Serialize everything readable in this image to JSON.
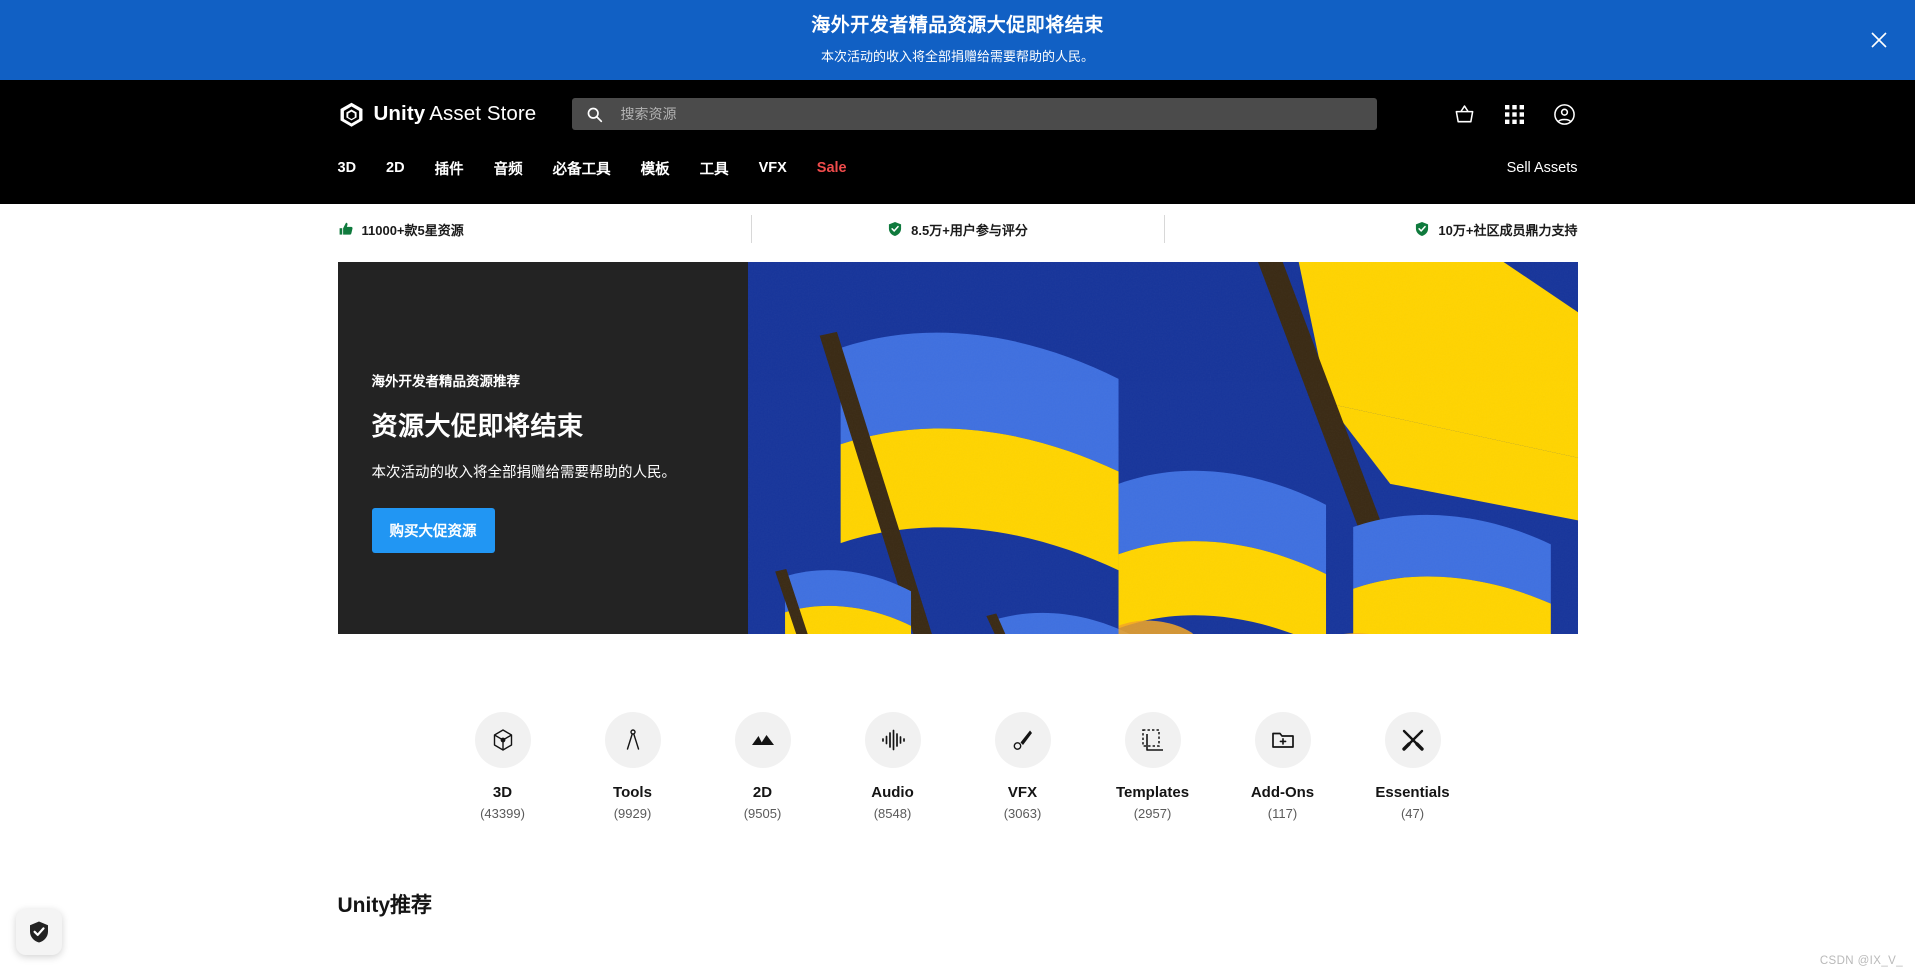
{
  "promo_banner": {
    "title": "海外开发者精品资源大促即将结束",
    "subtitle": "本次活动的收入将全部捐赠给需要帮助的人民。",
    "close_icon": "close-icon",
    "background_color": "#1160C4"
  },
  "header": {
    "logo": {
      "icon": "unity-cube-icon",
      "brand": "Unity",
      "product": "Asset Store"
    },
    "search": {
      "icon": "search-icon",
      "placeholder": "搜索资源",
      "value": ""
    },
    "icons": [
      {
        "name": "shopping-basket-icon",
        "label": "购物篮"
      },
      {
        "name": "apps-grid-icon",
        "label": "应用"
      },
      {
        "name": "account-circle-icon",
        "label": "账户"
      }
    ],
    "nav": [
      {
        "label": "3D",
        "highlight": false
      },
      {
        "label": "2D",
        "highlight": false
      },
      {
        "label": "插件",
        "highlight": false
      },
      {
        "label": "音频",
        "highlight": false
      },
      {
        "label": "必备工具",
        "highlight": false
      },
      {
        "label": "模板",
        "highlight": false
      },
      {
        "label": "工具",
        "highlight": false
      },
      {
        "label": "VFX",
        "highlight": false
      },
      {
        "label": "Sale",
        "highlight": true
      }
    ],
    "sell_assets": "Sell Assets",
    "sale_color": "#ef4b4b"
  },
  "trust_bar": [
    {
      "icon": "thumbs-up-icon",
      "text": "11000+款5星资源",
      "icon_color": "#0f7a3d"
    },
    {
      "icon": "shield-check-icon",
      "text": "8.5万+用户参与评分",
      "icon_color": "#0f7a3d"
    },
    {
      "icon": "shield-check-icon",
      "text": "10万+社区成员鼎力支持",
      "icon_color": "#0f7a3d"
    }
  ],
  "hero": {
    "eyebrow": "海外开发者精品资源推荐",
    "title": "资源大促即将结束",
    "subtitle": "本次活动的收入将全部捐赠给需要帮助的人民。",
    "cta_label": "购买大促资源",
    "cta_color": "#2196F3",
    "panel_color": "#232323",
    "art_background": "#17359B",
    "art_flag_blue": "#3a6bdb",
    "art_flag_yellow": "#FFD400",
    "art_pole_color": "#3a2a14"
  },
  "categories": [
    {
      "name": "3D",
      "count": "(43399)",
      "icon": "cube-3d-icon"
    },
    {
      "name": "Tools",
      "count": "(9929)",
      "icon": "compass-icon"
    },
    {
      "name": "2D",
      "count": "(9505)",
      "icon": "mountains-icon"
    },
    {
      "name": "Audio",
      "count": "(8548)",
      "icon": "waveform-icon"
    },
    {
      "name": "VFX",
      "count": "(3063)",
      "icon": "brush-icon"
    },
    {
      "name": "Templates",
      "count": "(2957)",
      "icon": "template-frame-icon"
    },
    {
      "name": "Add-Ons",
      "count": "(117)",
      "icon": "folder-plus-icon"
    },
    {
      "name": "Essentials",
      "count": "(47)",
      "icon": "tools-cross-icon"
    }
  ],
  "sections": {
    "recommended_title": "Unity推荐"
  },
  "privacy_badge": {
    "icon": "shield-check-icon"
  },
  "watermark": {
    "text": "CSDN @IX_V_"
  }
}
